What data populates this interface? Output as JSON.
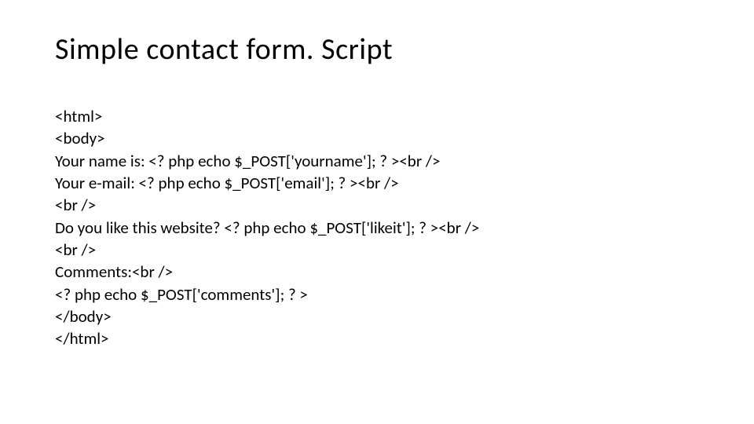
{
  "slide": {
    "title": "Simple contact form. Script",
    "code_lines": [
      "<html>",
      "<body>",
      "Your name is: <? php echo $_POST['yourname']; ? ><br />",
      "Your e-mail: <? php echo $_POST['email']; ? ><br />",
      "<br />",
      "Do you like this website? <? php echo $_POST['likeit']; ? ><br />",
      "<br />",
      "Comments:<br />",
      "<? php echo $_POST['comments']; ? >",
      "</body>",
      "</html>"
    ]
  }
}
